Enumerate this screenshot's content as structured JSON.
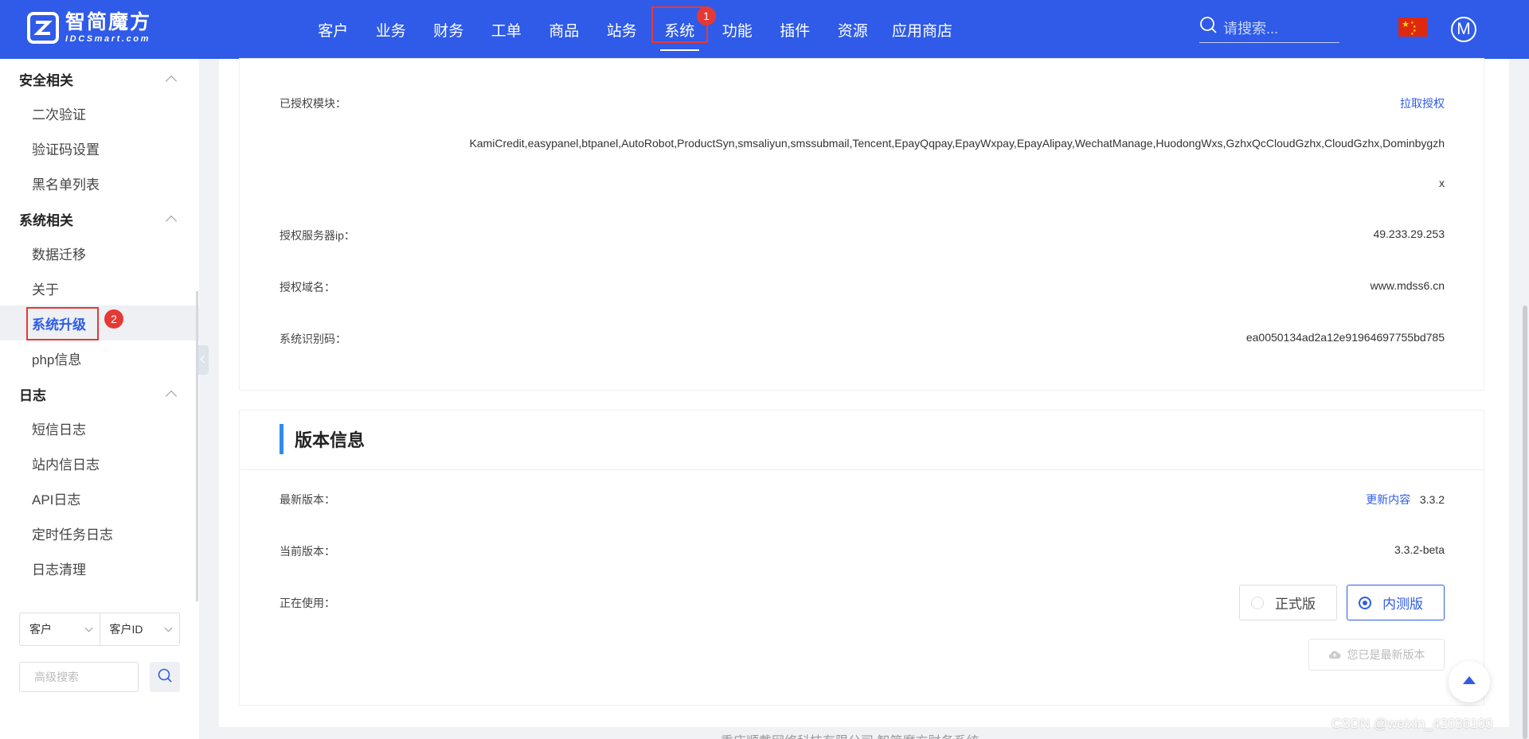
{
  "header": {
    "logo_cn": "智简魔方",
    "logo_en": "IDCSmart.com",
    "nav": [
      "客户",
      "业务",
      "财务",
      "工单",
      "商品",
      "站务",
      "系统",
      "功能",
      "插件",
      "资源",
      "应用商店"
    ],
    "active_nav": "系统",
    "search_placeholder": "请搜索...",
    "avatar_letter": "M",
    "badge_1": "1"
  },
  "sidebar": {
    "groups": [
      {
        "title": "安全相关",
        "items": [
          "二次验证",
          "验证码设置",
          "黑名单列表"
        ]
      },
      {
        "title": "系统相关",
        "items": [
          "数据迁移",
          "关于",
          "系统升级",
          "php信息"
        ]
      },
      {
        "title": "日志",
        "items": [
          "短信日志",
          "站内信日志",
          "API日志",
          "定时任务日志",
          "日志清理"
        ]
      }
    ],
    "active_item": "系统升级",
    "badge_2": "2",
    "select_1": "客户",
    "select_2": "客户ID",
    "adv_search_placeholder": "高级搜索"
  },
  "license": {
    "modules_label": "已授权模块：",
    "pull_link": "拉取授权",
    "modules_line1": "KamiCredit,easypanel,btpanel,AutoRobot,ProductSyn,smsaliyun,smssubmail,Tencent,EpayQqpay,EpayWxpay,EpayAlipay,WechatManage,HuodongWxs,GzhxQcCloudGzhx,CloudGzhx,Dominbygzh",
    "modules_line2": "x",
    "server_ip_label": "授权服务器ip：",
    "server_ip": "49.233.29.253",
    "domain_label": "授权域名：",
    "domain": "www.mdss6.cn",
    "sysid_label": "系统识别码：",
    "sysid": "ea0050134ad2a12e91964697755bd785"
  },
  "version": {
    "title": "版本信息",
    "latest_label": "最新版本：",
    "changelog_link": "更新内容",
    "latest": "3.3.2",
    "current_label": "当前版本：",
    "current": "3.3.2-beta",
    "using_label": "正在使用：",
    "option_stable": "正式版",
    "option_beta": "内测版",
    "selected": "内测版",
    "latest_button": "您已是最新版本"
  },
  "footer": {
    "text": "重庆顺戴网络科技有限公司 智简魔方财务系统",
    "watermark": "CSDN @weixin_42036100"
  },
  "colors": {
    "header_bg": "#2f5be8",
    "accent": "#2f5be8",
    "highlight": "#e53935",
    "section_bar": "#2f8cf0"
  }
}
